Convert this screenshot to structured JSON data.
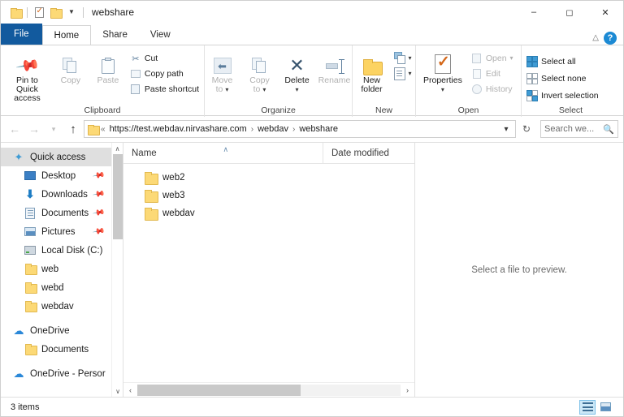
{
  "window": {
    "title": "webshare",
    "quick_access_toolbar": [
      {
        "name": "folder-icon",
        "label": "Folder"
      },
      {
        "name": "properties-icon",
        "label": "Properties"
      },
      {
        "name": "new-folder-icon",
        "label": "New folder"
      },
      {
        "name": "chevron-down-icon",
        "label": "Customize Quick Access Toolbar"
      }
    ],
    "controls": {
      "minimize": "–",
      "maximize": "☐",
      "close": "✕"
    }
  },
  "tabs": [
    {
      "id": "file",
      "label": "File"
    },
    {
      "id": "home",
      "label": "Home"
    },
    {
      "id": "share",
      "label": "Share"
    },
    {
      "id": "view",
      "label": "View"
    }
  ],
  "ribbon_controls": {
    "collapse": "∧",
    "help": "?"
  },
  "ribbon": {
    "groups": [
      {
        "name": "clipboard",
        "label": "Clipboard",
        "big_buttons": [
          {
            "name": "pin-to-quick-access",
            "label": "Pin to Quick\naccess",
            "line1": "Pin to Quick",
            "line2": "access",
            "disabled": false
          },
          {
            "name": "copy",
            "label": "Copy",
            "disabled": true
          },
          {
            "name": "paste",
            "label": "Paste",
            "disabled": true
          }
        ],
        "small_buttons": [
          {
            "name": "cut",
            "label": "Cut",
            "icon": "scissors-icon",
            "glyph": "✂"
          },
          {
            "name": "copy-path",
            "label": "Copy path",
            "icon": "copy-path-icon",
            "glyph": ""
          },
          {
            "name": "paste-shortcut",
            "label": "Paste shortcut",
            "icon": "paste-shortcut-icon",
            "glyph": ""
          }
        ]
      },
      {
        "name": "organize",
        "label": "Organize",
        "big_buttons": [
          {
            "name": "move-to",
            "line1": "Move",
            "line2": "to",
            "disabled": true,
            "has_caret": true
          },
          {
            "name": "copy-to",
            "line1": "Copy",
            "line2": "to",
            "disabled": true,
            "has_caret": true
          },
          {
            "name": "delete",
            "line1": "Delete",
            "line2": "",
            "disabled": false,
            "has_caret": true
          },
          {
            "name": "rename",
            "line1": "Rename",
            "line2": "",
            "disabled": true,
            "has_caret": false
          }
        ]
      },
      {
        "name": "new",
        "label": "New",
        "big_buttons": [
          {
            "name": "new-folder",
            "line1": "New",
            "line2": "folder",
            "disabled": false
          }
        ],
        "small_buttons": [
          {
            "name": "new-item",
            "label": "",
            "icon": "new-item-icon"
          },
          {
            "name": "easy-access",
            "label": "",
            "icon": "easy-access-icon"
          }
        ]
      },
      {
        "name": "open",
        "label": "Open",
        "big_buttons": [
          {
            "name": "properties",
            "line1": "Properties",
            "line2": "",
            "disabled": false,
            "has_caret": true
          }
        ],
        "small_buttons": [
          {
            "name": "open",
            "label": "Open",
            "disabled": true,
            "has_caret": true
          },
          {
            "name": "edit",
            "label": "Edit",
            "disabled": true
          },
          {
            "name": "history",
            "label": "History",
            "disabled": true
          }
        ]
      },
      {
        "name": "select",
        "label": "Select",
        "small_buttons": [
          {
            "name": "select-all",
            "label": "Select all"
          },
          {
            "name": "select-none",
            "label": "Select none"
          },
          {
            "name": "invert-selection",
            "label": "Invert selection"
          }
        ]
      }
    ]
  },
  "addressbar": {
    "back": "←",
    "forward": "→",
    "recent": "∨",
    "up": "↑",
    "overflow": "«",
    "crumbs": [
      {
        "label": "https://test.webdav.nirvashare.com"
      },
      {
        "label": "webdav"
      },
      {
        "label": "webshare"
      }
    ],
    "separator": "›",
    "dropdown": "∨",
    "refresh": "↻",
    "search_placeholder": "Search we...",
    "search_value": "",
    "search_icon": "magnifier-icon"
  },
  "sidebar": {
    "items": [
      {
        "label": "Quick access",
        "icon": "star-icon",
        "indent": 0,
        "selected": true,
        "pinned": false
      },
      {
        "label": "Desktop",
        "icon": "desktop-icon",
        "indent": 1,
        "selected": false,
        "pinned": true
      },
      {
        "label": "Downloads",
        "icon": "downloads-icon",
        "indent": 1,
        "selected": false,
        "pinned": true
      },
      {
        "label": "Documents",
        "icon": "documents-icon",
        "indent": 1,
        "selected": false,
        "pinned": true
      },
      {
        "label": "Pictures",
        "icon": "pictures-icon",
        "indent": 1,
        "selected": false,
        "pinned": true
      },
      {
        "label": "Local Disk (C:)",
        "icon": "disk-icon",
        "indent": 1,
        "selected": false,
        "pinned": false
      },
      {
        "label": "web",
        "icon": "folder-icon",
        "indent": 1,
        "selected": false,
        "pinned": false
      },
      {
        "label": "webd",
        "icon": "folder-icon",
        "indent": 1,
        "selected": false,
        "pinned": false
      },
      {
        "label": "webdav",
        "icon": "folder-icon",
        "indent": 1,
        "selected": false,
        "pinned": false
      },
      {
        "label": "OneDrive",
        "icon": "cloud-icon",
        "indent": 0,
        "selected": false,
        "pinned": false
      },
      {
        "label": "Documents",
        "icon": "folder-icon",
        "indent": 1,
        "selected": false,
        "pinned": false
      },
      {
        "label": "OneDrive - Persor",
        "icon": "cloud-icon",
        "indent": 0,
        "selected": false,
        "pinned": false
      }
    ],
    "scroll_up": "∧",
    "scroll_down": "∨"
  },
  "filelist": {
    "columns": [
      {
        "name": "name",
        "label": "Name",
        "sorted": true,
        "sort_arrow": "∧"
      },
      {
        "name": "date-modified",
        "label": "Date modified",
        "sorted": false
      }
    ],
    "rows": [
      {
        "name": "web2",
        "icon": "folder-icon",
        "date_modified": ""
      },
      {
        "name": "web3",
        "icon": "folder-icon",
        "date_modified": ""
      },
      {
        "name": "webdav",
        "icon": "folder-icon",
        "date_modified": ""
      }
    ],
    "hscroll": {
      "left": "‹",
      "right": "›"
    }
  },
  "preview": {
    "message": "Select a file to preview."
  },
  "statusbar": {
    "item_count": "3 items",
    "view_buttons": [
      {
        "name": "details-view",
        "active": true
      },
      {
        "name": "large-icons-view",
        "active": false
      }
    ]
  },
  "colors": {
    "file_tab": "#125a9e",
    "accent": "#0078d7",
    "folder": "#fcd976",
    "selection": "#dfdfdf",
    "help_blue": "#1c8ad4"
  }
}
